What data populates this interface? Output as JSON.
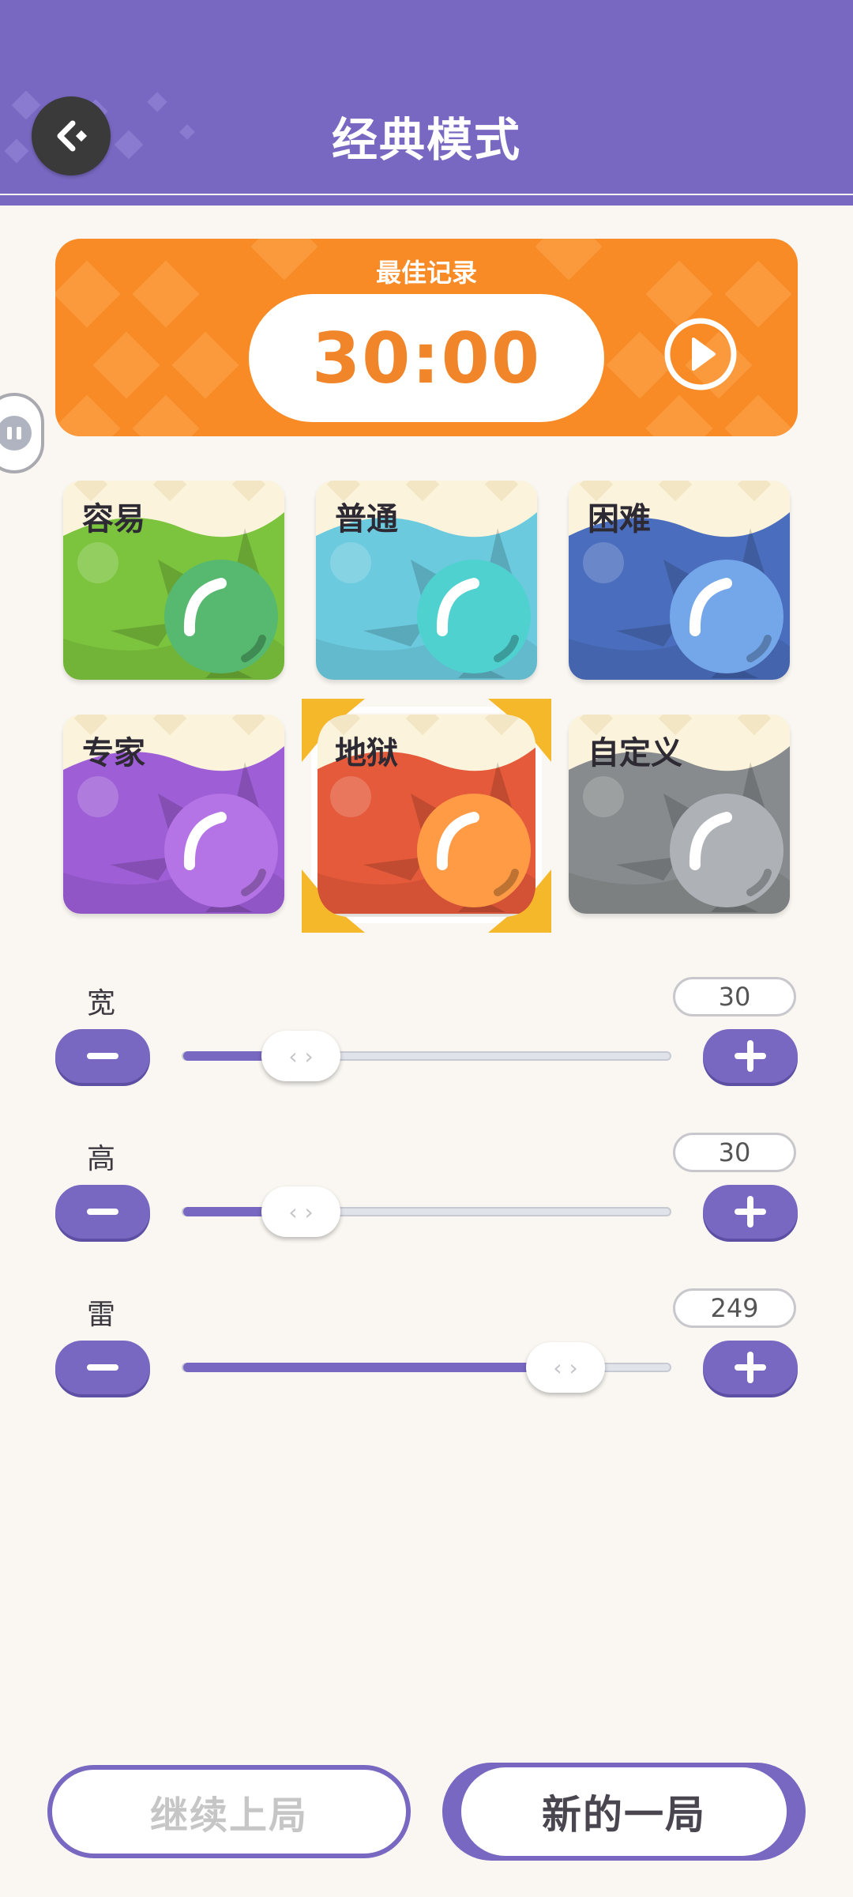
{
  "header": {
    "title": "经典模式"
  },
  "record": {
    "label": "最佳记录",
    "time": "30:00"
  },
  "difficulties": [
    {
      "label": "容易",
      "color": "#7cc43d",
      "ball": "#56b96f"
    },
    {
      "label": "普通",
      "color": "#6ccadf",
      "ball": "#4fd1cf"
    },
    {
      "label": "困难",
      "color": "#4a6ebd",
      "ball": "#74a6ea"
    },
    {
      "label": "专家",
      "color": "#9e5ed6",
      "ball": "#b474e6"
    },
    {
      "label": "地狱",
      "color": "#e55a3a",
      "ball": "#ff9a45",
      "selected": true
    },
    {
      "label": "自定义",
      "color": "#878b8d",
      "ball": "#aeb2b6"
    }
  ],
  "settings": [
    {
      "label": "宽",
      "value": "30",
      "fraction": 0.24
    },
    {
      "label": "高",
      "value": "30",
      "fraction": 0.24
    },
    {
      "label": "雷",
      "value": "249",
      "fraction": 0.78
    }
  ],
  "buttons": {
    "continue": "继续上局",
    "new_game": "新的一局"
  },
  "colors": {
    "accent": "#7868c1",
    "record": "#f88b26",
    "selected_frame": "#f5b82a"
  }
}
